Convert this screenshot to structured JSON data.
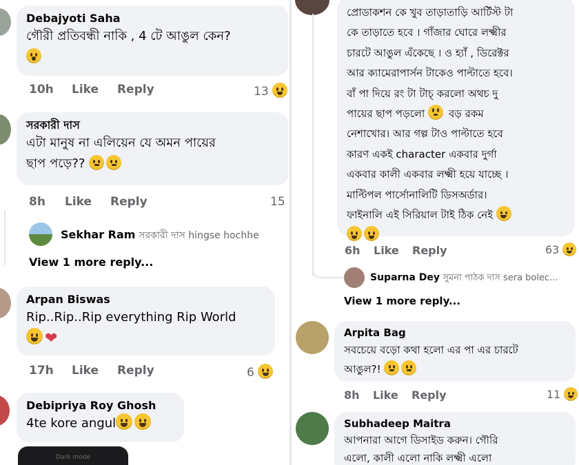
{
  "left": {
    "comments": [
      {
        "name": "Debajyoti Saha",
        "text": "গৌরী প্রতিবন্ধী নাকি , 4 টে আঙুল কেন?",
        "emoji": "wow-icon",
        "time": "10h",
        "like": "Like",
        "reply": "Reply",
        "reactions": "13"
      },
      {
        "name": "সরকারী দাস",
        "text_line1": "এটা মানুষ না এলিয়েন যে অমন পায়ের",
        "text_line2": "ছাপ পড়ে??",
        "emoji": "flushed-icon",
        "time": "8h",
        "like": "Like",
        "reply": "Reply",
        "reactions": "15",
        "reply_preview": {
          "name": "Sekhar Ram",
          "snippet": "সরকারী দাস hingse hochhe"
        },
        "more_replies": "View 1 more reply..."
      },
      {
        "name": "Arpan Biswas",
        "text": "Rip..Rip..Rip everything Rip World",
        "emoji": "smile-heart",
        "time": "17h",
        "like": "Like",
        "reply": "Reply",
        "reactions": "6"
      },
      {
        "name": "Debipriya Roy Ghosh",
        "text": "4te kore angul",
        "emoji": "smile-icon"
      }
    ],
    "phone_bar_text": "Dark mode"
  },
  "right": {
    "comment1": {
      "lines": [
        "প্রোডাকশন কে খুব তাড়াতাড়ি আর্টিস্ট টা",
        "কে তাড়াতে হবে । গাঁজার ঘোরে লক্ষ্মীর",
        "চারটে আঙুল এঁকেছে । ও হ্যাঁ , ডিরেক্টর",
        "আর ক্যামেরাপার্সন টাকেও পাল্টাতে হবে।",
        "বাঁ পা দিয়ে রং টা টাচ্ করলো অথচ দু",
        "পায়ের ছাপ পড়লো",
        "বড় রকম",
        "নেশাখোর। আর গল্প টাও পাল্টাতে হবে",
        "কারণ একই character একবার দুর্গা",
        "একবার কালী একবার লক্ষ্মী হয়ে যাচ্ছে ।",
        "মাল্টিপল পার্সোনালিটি ডিসঅর্ডার।",
        "ফাইনালি এই সিরিয়াল টাই ঠিক নেই"
      ],
      "time": "6h",
      "like": "Like",
      "reply": "Reply",
      "reactions": "63",
      "reply_preview": {
        "name": "Suparna Dey",
        "snippet": "সুমনা পাঠক দাস sera bolec..."
      },
      "more_replies": "View 1 more reply..."
    },
    "comment2": {
      "name": "Arpita Bag",
      "text_line1": "সবচেয়ে বড়ো কথা হলো এর পা এর চারটে",
      "text_line2": "আঙুল?!",
      "time": "8h",
      "like": "Like",
      "reply": "Reply",
      "reactions": "11"
    },
    "comment3": {
      "name": "Subhadeep Maitra",
      "text_line1": "আপনারা আগে ডিসাইড করুন। গৌরি",
      "text_line2": "এলো, কালী এলো নাকি লক্ষ্মী এলো"
    }
  },
  "colors": {
    "bubble": "#f0f2f5",
    "meta": "#65676b",
    "name": "#050505",
    "emoji": "#f7c531"
  }
}
